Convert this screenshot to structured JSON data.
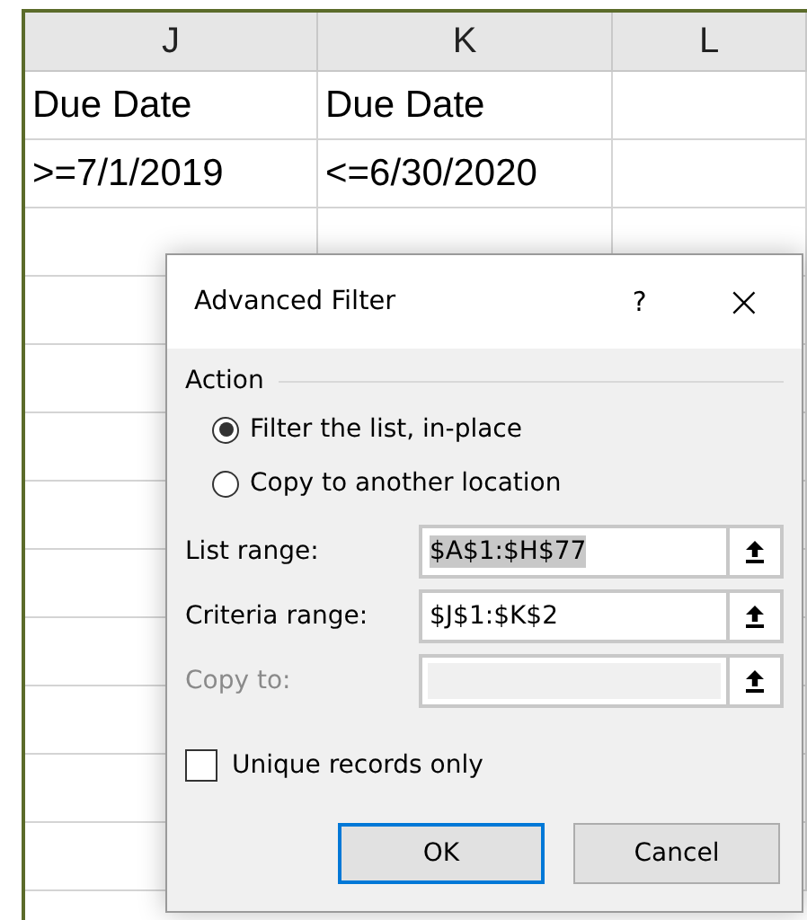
{
  "sheet": {
    "columns": [
      "J",
      "K",
      "L"
    ],
    "rows": [
      {
        "cells": [
          "Due Date",
          "Due Date"
        ]
      },
      {
        "cells": [
          ">=7/1/2019",
          "<=6/30/2020"
        ]
      }
    ]
  },
  "dialog": {
    "title": "Advanced Filter",
    "help": "?",
    "close": "×",
    "section": "Action",
    "options": [
      {
        "label": "Filter the list, in-place",
        "selected": true
      },
      {
        "label": "Copy to another location",
        "selected": false
      }
    ],
    "fields": [
      {
        "label": "List range:",
        "value": "$A$1:$H$77",
        "highlighted": true,
        "disabled": false
      },
      {
        "label": "Criteria range:",
        "value": "$J$1:$K$2",
        "highlighted": false,
        "disabled": false
      },
      {
        "label": "Copy to:",
        "disabled": true
      }
    ],
    "checkbox": {
      "label": "Unique records only",
      "checked": false
    },
    "buttons": [
      {
        "label": "OK",
        "default": true
      },
      {
        "label": "Cancel",
        "default": false
      }
    ]
  }
}
